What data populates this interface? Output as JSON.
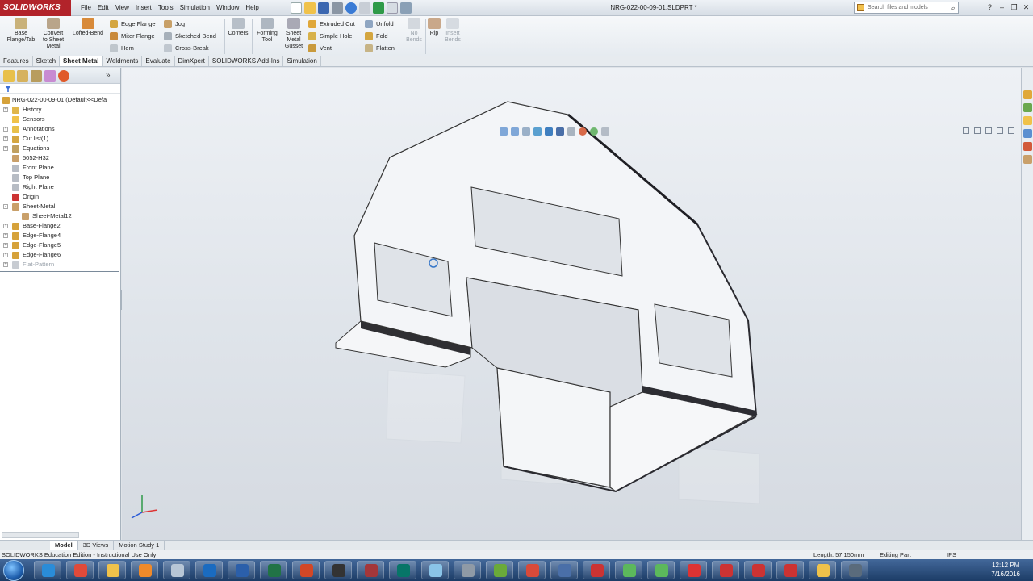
{
  "app": {
    "logo": "SOLIDWORKS",
    "document_title": "NRG-022-00-09-01.SLDPRT *",
    "menus": [
      "File",
      "Edit",
      "View",
      "Insert",
      "Tools",
      "Simulation",
      "Window",
      "Help"
    ],
    "search_placeholder": "Search files and models"
  },
  "ribbon": {
    "big_buttons": [
      {
        "label": "Base\nFlange/Tab"
      },
      {
        "label": "Convert\nto Sheet\nMetal"
      },
      {
        "label": "Lofted-Bend"
      },
      {
        "label": "Corners"
      },
      {
        "label": "Forming\nTool"
      },
      {
        "label": "Sheet\nMetal\nGusset"
      },
      {
        "label": "No\nBends"
      },
      {
        "label": "Rip"
      },
      {
        "label": "Insert\nBends"
      }
    ],
    "col1": [
      "Edge Flange",
      "Miter Flange",
      "Hem"
    ],
    "col2": [
      "Jog",
      "Sketched Bend",
      "Cross-Break"
    ],
    "col3": [
      "Extruded Cut",
      "Simple Hole",
      "Vent"
    ],
    "col4": [
      "Unfold",
      "Fold",
      "Flatten"
    ]
  },
  "tabs": [
    "Features",
    "Sketch",
    "Sheet Metal",
    "Weldments",
    "Evaluate",
    "DimXpert",
    "SOLIDWORKS Add-Ins",
    "Simulation"
  ],
  "active_tab": "Sheet Metal",
  "tree": {
    "root": "NRG-022-00-09-01  (Default<<Defa",
    "items": [
      {
        "label": "History",
        "level": 1,
        "expand": "+"
      },
      {
        "label": "Sensors",
        "level": 1,
        "expand": ""
      },
      {
        "label": "Annotations",
        "level": 1,
        "expand": "+"
      },
      {
        "label": "Cut list(1)",
        "level": 1,
        "expand": "+"
      },
      {
        "label": "Equations",
        "level": 1,
        "expand": "+"
      },
      {
        "label": "5052-H32",
        "level": 1,
        "expand": ""
      },
      {
        "label": "Front Plane",
        "level": 1,
        "expand": ""
      },
      {
        "label": "Top Plane",
        "level": 1,
        "expand": ""
      },
      {
        "label": "Right Plane",
        "level": 1,
        "expand": ""
      },
      {
        "label": "Origin",
        "level": 1,
        "expand": ""
      },
      {
        "label": "Sheet-Metal",
        "level": 1,
        "expand": "-"
      },
      {
        "label": "Sheet-Metal12",
        "level": 2,
        "expand": ""
      },
      {
        "label": "Base-Flange2",
        "level": 1,
        "expand": "+"
      },
      {
        "label": "Edge-Flange4",
        "level": 1,
        "expand": "+"
      },
      {
        "label": "Edge-Flange5",
        "level": 1,
        "expand": "+"
      },
      {
        "label": "Edge-Flange6",
        "level": 1,
        "expand": "+"
      },
      {
        "label": "Flat-Pattern",
        "level": 1,
        "expand": "+"
      }
    ]
  },
  "bottom_tabs": [
    "Model",
    "3D Views",
    "Motion Study 1"
  ],
  "active_bottom_tab": "Model",
  "status": {
    "edition": "SOLIDWORKS Education Edition - Instructional Use Only",
    "length": "Length: 57.150mm",
    "mode": "Editing Part",
    "units": "IPS"
  },
  "taskbar": {
    "time": "12:12 PM",
    "date": "7/16/2016"
  },
  "colors": {
    "brand": "#b2232a",
    "part_face": "#f2f4f7",
    "part_edge": "#2b2b30"
  }
}
